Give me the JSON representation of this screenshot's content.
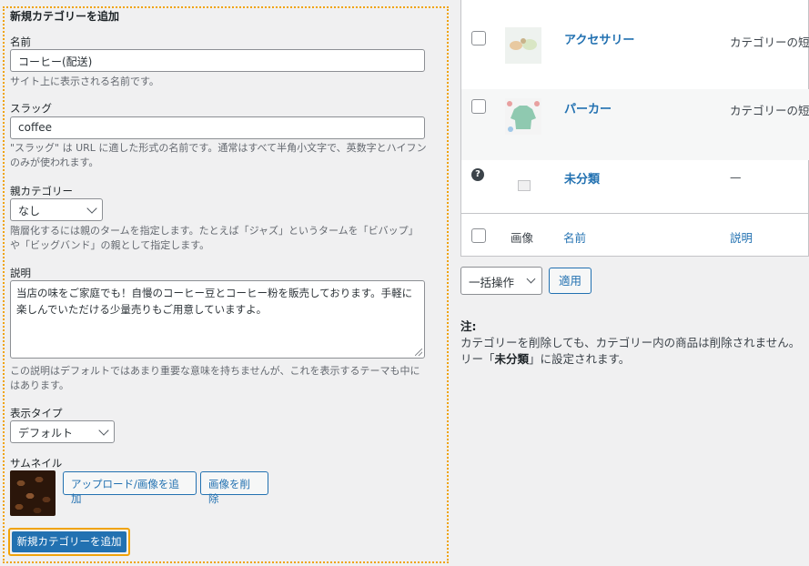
{
  "form": {
    "heading": "新規カテゴリーを追加",
    "name_label": "名前",
    "name_value": "コーヒー(配送)",
    "name_help": "サイト上に表示される名前です。",
    "slug_label": "スラッグ",
    "slug_value": "coffee",
    "slug_help": "\"スラッグ\" は URL に適した形式の名前です。通常はすべて半角小文字で、英数字とハイフンのみが使われます。",
    "parent_label": "親カテゴリー",
    "parent_value": "なし",
    "parent_help": "階層化するには親のタームを指定します。たとえば「ジャズ」というタームを「ビバップ」や「ビッグバンド」の親として指定します。",
    "description_label": "説明",
    "description_value": "当店の味をご家庭でも！自慢のコーヒー豆とコーヒー粉を販売しております。手軽に楽しんでいただける少量売りもご用意していますよ。",
    "description_help": "この説明はデフォルトではあまり重要な意味を持ちませんが、これを表示するテーマも中にはあります。",
    "display_type_label": "表示タイプ",
    "display_type_value": "デフォルト",
    "thumbnail_label": "サムネイル",
    "upload_button": "アップロード/画像を追加",
    "remove_image_button": "画像を削除",
    "submit_button": "新規カテゴリーを追加"
  },
  "table": {
    "rows": [
      {
        "name": "アクセサリー",
        "description": "カテゴリーの短"
      },
      {
        "name": "パーカー",
        "description": "カテゴリーの短"
      },
      {
        "name": "未分類",
        "description": "—"
      }
    ],
    "footer": {
      "image": "画像",
      "name": "名前",
      "description": "説明"
    },
    "help_icon_glyph": "?"
  },
  "bulk": {
    "select_value": "一括操作",
    "apply_button": "適用"
  },
  "note": {
    "title": "注:",
    "line1": "カテゴリーを削除しても、カテゴリー内の商品は削除されません。",
    "line2_prefix": "リー「",
    "line2_bold": "未分類",
    "line2_suffix": "」に設定されます。"
  },
  "colors": {
    "accent": "#2271b1",
    "highlight_border": "#f0a30a"
  }
}
